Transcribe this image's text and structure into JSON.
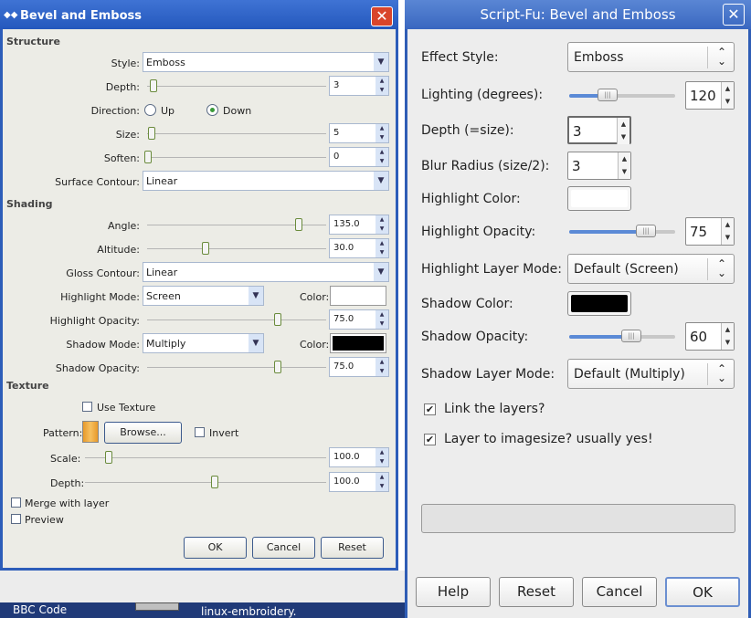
{
  "left_dialog": {
    "title": "Bevel and Emboss",
    "close_glyph": "✕",
    "window_icon": "window-menu-icon",
    "structure": {
      "heading": "Structure",
      "style_label": "Style:",
      "style_value": "Emboss",
      "depth_label": "Depth:",
      "depth_value": "3",
      "direction_label": "Direction:",
      "direction_up": "Up",
      "direction_down": "Down",
      "direction_selected": "Down",
      "size_label": "Size:",
      "size_value": "5",
      "soften_label": "Soften:",
      "soften_value": "0",
      "surface_label": "Surface Contour:",
      "surface_value": "Linear"
    },
    "shading": {
      "heading": "Shading",
      "angle_label": "Angle:",
      "angle_value": "135.0",
      "altitude_label": "Altitude:",
      "altitude_value": "30.0",
      "gloss_label": "Gloss Contour:",
      "gloss_value": "Linear",
      "highlight_mode_label": "Highlight Mode:",
      "highlight_mode_value": "Screen",
      "highlight_color_label": "Color:",
      "highlight_color": "#ffffff",
      "highlight_opacity_label": "Highlight Opacity:",
      "highlight_opacity_value": "75.0",
      "shadow_mode_label": "Shadow Mode:",
      "shadow_mode_value": "Multiply",
      "shadow_color_label": "Color:",
      "shadow_color": "#000000",
      "shadow_opacity_label": "Shadow Opacity:",
      "shadow_opacity_value": "75.0"
    },
    "texture": {
      "heading": "Texture",
      "use_texture_label": "Use Texture",
      "pattern_label": "Pattern:",
      "browse_label": "Browse...",
      "invert_label": "Invert",
      "scale_label": "Scale:",
      "scale_value": "100.0",
      "depth_label": "Depth:",
      "depth_value": "100.0"
    },
    "merge_label": "Merge with layer",
    "preview_label": "Preview",
    "ok_label": "OK",
    "cancel_label": "Cancel",
    "reset_label": "Reset"
  },
  "taskbar": {
    "item1": "BBC Code",
    "item2": "linux-embroidery."
  },
  "right_dialog": {
    "title": "Script-Fu: Bevel and Emboss",
    "close_glyph": "✕",
    "effect_style_label": "Effect Style:",
    "effect_style_value": "Emboss",
    "lighting_label": "Lighting (degrees):",
    "lighting_value": "120",
    "depth_label": "Depth (=size):",
    "depth_value": "3",
    "blur_label": "Blur Radius (size/2):",
    "blur_value": "3",
    "highlight_color_label": "Highlight Color:",
    "highlight_color": "#ffffff",
    "highlight_opacity_label": "Highlight Opacity:",
    "highlight_opacity_value": "75",
    "highlight_mode_label": "Highlight Layer Mode:",
    "highlight_mode_value": "Default (Screen)",
    "shadow_color_label": "Shadow Color:",
    "shadow_color": "#000000",
    "shadow_opacity_label": "Shadow Opacity:",
    "shadow_opacity_value": "60",
    "shadow_mode_label": "Shadow Layer Mode:",
    "shadow_mode_value": "Default (Multiply)",
    "link_layers_label": "Link the layers?",
    "link_layers_checked": true,
    "layer_to_image_label": "Layer to imagesize? usually yes!",
    "layer_to_image_checked": true,
    "check_glyph": "✔",
    "help_label": "Help",
    "reset_label": "Reset",
    "cancel_label": "Cancel",
    "ok_label": "OK"
  }
}
